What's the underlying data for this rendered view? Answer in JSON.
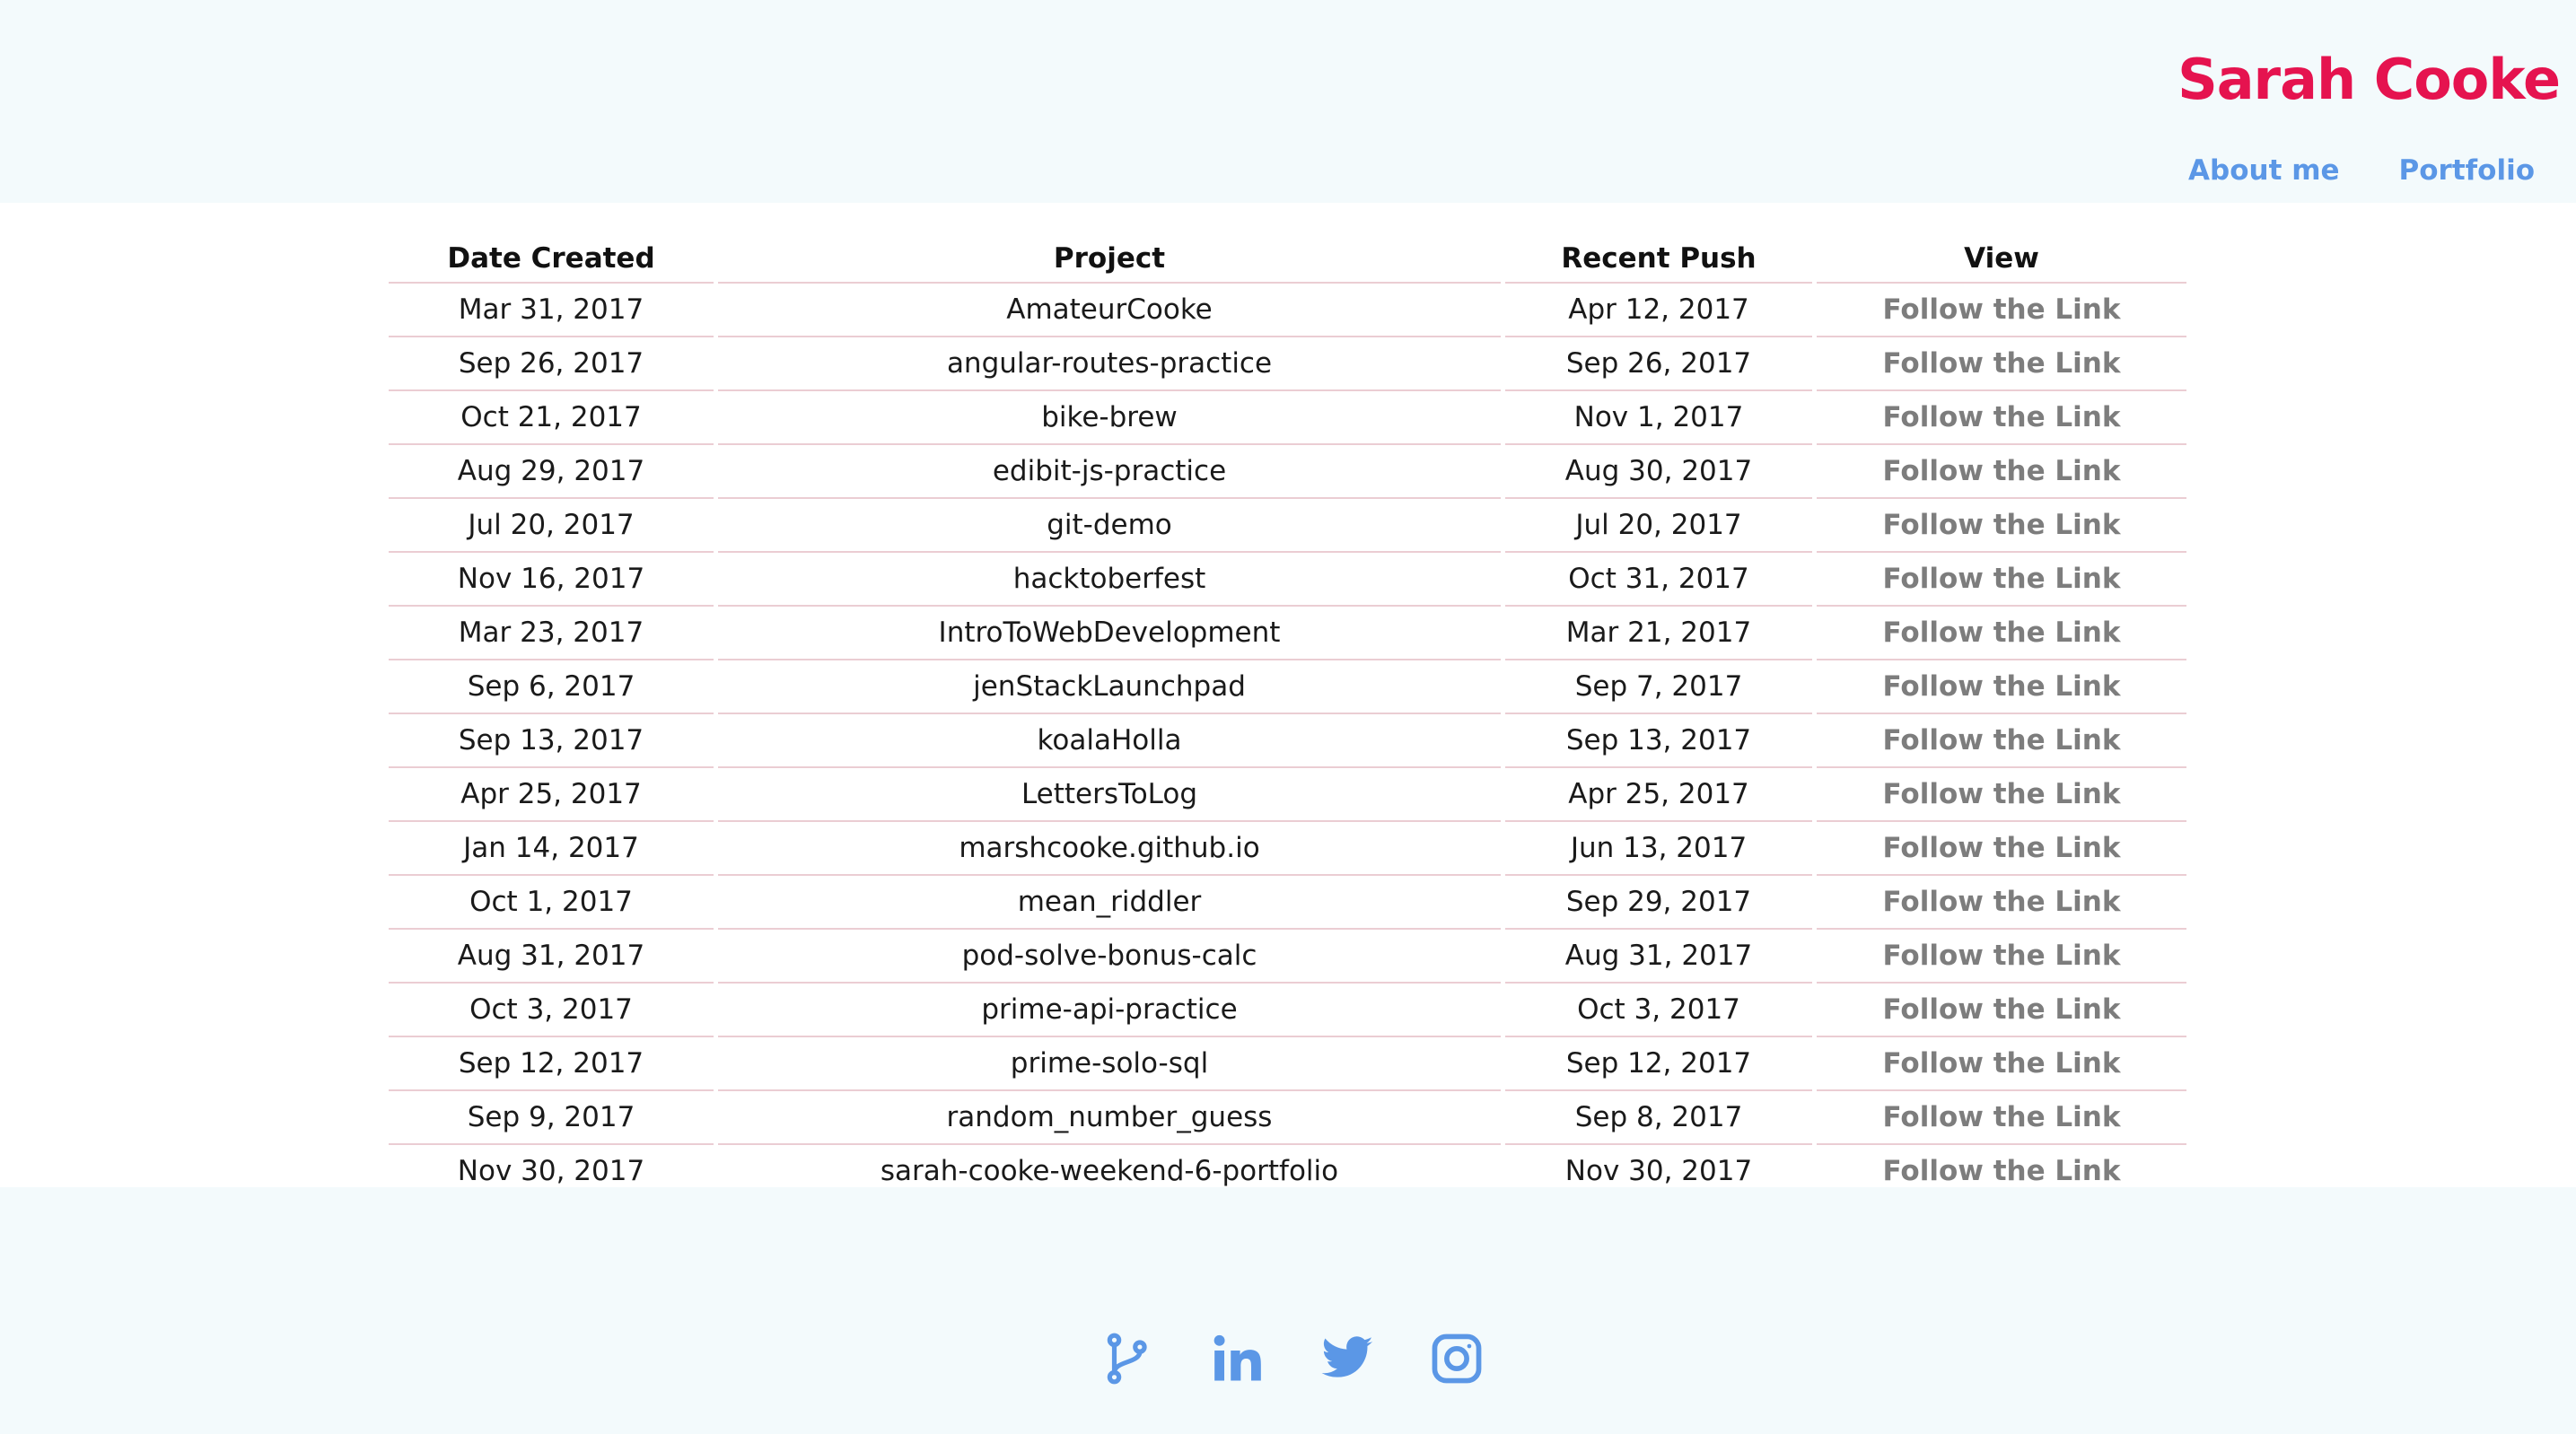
{
  "header": {
    "brand": "Sarah Cooke",
    "nav": [
      {
        "label": "About me"
      },
      {
        "label": "Portfolio"
      }
    ]
  },
  "table": {
    "columns": [
      "Date Created",
      "Project",
      "Recent Push",
      "View"
    ],
    "rows": [
      {
        "created": "Mar 31, 2017",
        "project": "AmateurCooke",
        "push": "Apr 12, 2017",
        "view": "Follow the Link"
      },
      {
        "created": "Sep 26, 2017",
        "project": "angular-routes-practice",
        "push": "Sep 26, 2017",
        "view": "Follow the Link"
      },
      {
        "created": "Oct 21, 2017",
        "project": "bike-brew",
        "push": "Nov 1, 2017",
        "view": "Follow the Link"
      },
      {
        "created": "Aug 29, 2017",
        "project": "edibit-js-practice",
        "push": "Aug 30, 2017",
        "view": "Follow the Link"
      },
      {
        "created": "Jul 20, 2017",
        "project": "git-demo",
        "push": "Jul 20, 2017",
        "view": "Follow the Link"
      },
      {
        "created": "Nov 16, 2017",
        "project": "hacktoberfest",
        "push": "Oct 31, 2017",
        "view": "Follow the Link"
      },
      {
        "created": "Mar 23, 2017",
        "project": "IntroToWebDevelopment",
        "push": "Mar 21, 2017",
        "view": "Follow the Link"
      },
      {
        "created": "Sep 6, 2017",
        "project": "jenStackLaunchpad",
        "push": "Sep 7, 2017",
        "view": "Follow the Link"
      },
      {
        "created": "Sep 13, 2017",
        "project": "koalaHolla",
        "push": "Sep 13, 2017",
        "view": "Follow the Link"
      },
      {
        "created": "Apr 25, 2017",
        "project": "LettersToLog",
        "push": "Apr 25, 2017",
        "view": "Follow the Link"
      },
      {
        "created": "Jan 14, 2017",
        "project": "marshcooke.github.io",
        "push": "Jun 13, 2017",
        "view": "Follow the Link"
      },
      {
        "created": "Oct 1, 2017",
        "project": "mean_riddler",
        "push": "Sep 29, 2017",
        "view": "Follow the Link"
      },
      {
        "created": "Aug 31, 2017",
        "project": "pod-solve-bonus-calc",
        "push": "Aug 31, 2017",
        "view": "Follow the Link"
      },
      {
        "created": "Oct 3, 2017",
        "project": "prime-api-practice",
        "push": "Oct 3, 2017",
        "view": "Follow the Link"
      },
      {
        "created": "Sep 12, 2017",
        "project": "prime-solo-sql",
        "push": "Sep 12, 2017",
        "view": "Follow the Link"
      },
      {
        "created": "Sep 9, 2017",
        "project": "random_number_guess",
        "push": "Sep 8, 2017",
        "view": "Follow the Link"
      },
      {
        "created": "Nov 30, 2017",
        "project": "sarah-cooke-weekend-6-portfolio",
        "push": "Nov 30, 2017",
        "view": "Follow the Link"
      }
    ]
  },
  "footer": {
    "icons": [
      "git-branch-icon",
      "linkedin-icon",
      "twitter-icon",
      "instagram-icon"
    ],
    "icon_color": "#5b97e6"
  },
  "colors": {
    "brand": "#e5134f",
    "nav": "#5b97e6",
    "row_border": "#ebcdd3",
    "link": "#7d7d7d",
    "background": "#f3fafc"
  }
}
